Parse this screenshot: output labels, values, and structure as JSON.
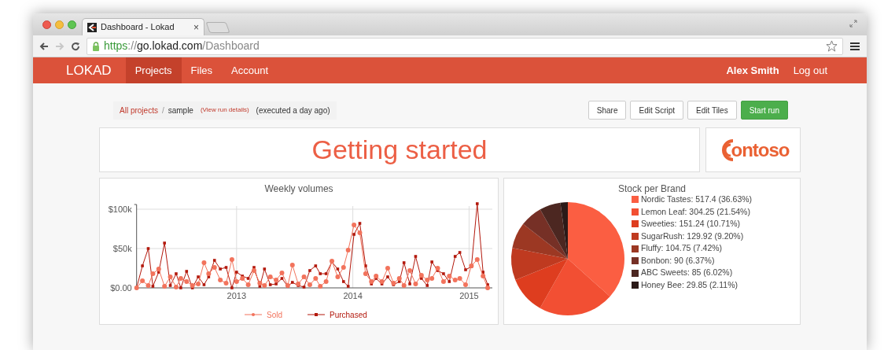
{
  "browser": {
    "tab": {
      "title": "Dashboard - Lokad",
      "close": "×"
    },
    "forward_disabled": true,
    "url": {
      "scheme": "https",
      "separator": "://",
      "host": "go.lokad.com",
      "path": "/Dashboard"
    }
  },
  "navbar": {
    "brand": "LOKAD",
    "items": [
      {
        "label": "Projects",
        "selected": true
      },
      {
        "label": "Files",
        "selected": false
      },
      {
        "label": "Account",
        "selected": false
      }
    ],
    "user": "Alex Smith",
    "logout": "Log out"
  },
  "breadcrumb": {
    "root": "All projects",
    "separator": "/",
    "current": "sample",
    "details_link": "(View run details)",
    "status": "(executed a day ago)"
  },
  "actions": [
    {
      "label": "Share",
      "kind": "default"
    },
    {
      "label": "Edit Script",
      "kind": "default"
    },
    {
      "label": "Edit Tiles",
      "kind": "default"
    },
    {
      "label": "Start run",
      "kind": "primary"
    }
  ],
  "title_tile": {
    "text": "Getting started"
  },
  "logo_tile": {
    "text": "ontoso"
  },
  "line_tile": {
    "chart_data": {
      "type": "line",
      "title": "Weekly volumes",
      "x": [
        2012.14,
        2012.19,
        2012.24,
        2012.28,
        2012.33,
        2012.38,
        2012.43,
        2012.48,
        2012.52,
        2012.57,
        2012.62,
        2012.67,
        2012.72,
        2012.76,
        2012.81,
        2012.86,
        2012.91,
        2012.96,
        2013.0,
        2013.05,
        2013.1,
        2013.15,
        2013.2,
        2013.24,
        2013.29,
        2013.34,
        2013.39,
        2013.44,
        2013.48,
        2013.53,
        2013.58,
        2013.63,
        2013.68,
        2013.72,
        2013.77,
        2013.82,
        2013.87,
        2013.92,
        2013.96,
        2014.01,
        2014.06,
        2014.11,
        2014.16,
        2014.2,
        2014.25,
        2014.3,
        2014.35,
        2014.4,
        2014.44,
        2014.49,
        2014.54,
        2014.59,
        2014.64,
        2014.68,
        2014.73,
        2014.78,
        2014.83,
        2014.88,
        2014.92,
        2014.97,
        2015.02,
        2015.07,
        2015.12,
        2015.16
      ],
      "series": [
        {
          "name": "Sold",
          "color": "#f2735c",
          "marker": "circle",
          "values": [
            0,
            9000,
            3000,
            18000,
            24000,
            2000,
            14000,
            1000,
            12000,
            8000,
            3000,
            5000,
            32000,
            18000,
            26000,
            10000,
            6000,
            36000,
            8000,
            12000,
            4000,
            22000,
            6000,
            3000,
            14000,
            10000,
            19000,
            3000,
            29000,
            5000,
            14000,
            4000,
            12000,
            2000,
            8000,
            34000,
            14000,
            26000,
            48000,
            80000,
            70000,
            18000,
            8000,
            15000,
            8000,
            25000,
            6000,
            12000,
            3000,
            22000,
            5000,
            16000,
            10000,
            12000,
            25000,
            8000,
            15000,
            10000,
            12000,
            4000,
            28000,
            36000,
            15000,
            0
          ]
        },
        {
          "name": "Purchased",
          "color": "#b3190d",
          "marker": "square",
          "values": [
            0,
            28000,
            50000,
            2000,
            20000,
            57000,
            3000,
            18000,
            0,
            21000,
            0,
            14000,
            4000,
            14000,
            35000,
            24000,
            26000,
            0,
            20000,
            15000,
            12000,
            26000,
            2000,
            24000,
            4000,
            5000,
            12000,
            2000,
            7000,
            3000,
            1000,
            22000,
            28000,
            18000,
            18000,
            33000,
            24000,
            8000,
            2000,
            68000,
            82000,
            28000,
            5000,
            12000,
            5000,
            14000,
            4000,
            8000,
            32000,
            5000,
            40000,
            12000,
            3000,
            33000,
            22000,
            18000,
            8000,
            40000,
            45000,
            23000,
            27000,
            107000,
            20000,
            4000
          ]
        }
      ],
      "grid": true,
      "legend": true,
      "xlim": [
        2012.14,
        2015.2
      ],
      "ylim": [
        0,
        107000
      ],
      "xticks": [
        2013,
        2014,
        2015
      ],
      "yticks": [
        {
          "value": 0,
          "label": "$0.00"
        },
        {
          "value": 50000,
          "label": "$50k"
        },
        {
          "value": 100000,
          "label": "$100k"
        }
      ]
    }
  },
  "pie_tile": {
    "chart_data": {
      "type": "pie",
      "title": "Stock per Brand",
      "values": [
        36.63,
        21.54,
        10.71,
        9.2,
        7.42,
        6.37,
        6.02,
        2.11
      ]
    },
    "legend": [
      {
        "label": "Nordic Tastes: 517.4 (36.63%)",
        "color": "#fb5e42"
      },
      {
        "label": "Lemon Leaf: 304.25 (21.54%)",
        "color": "#f24f33"
      },
      {
        "label": "Sweeties: 151.24 (10.71%)",
        "color": "#de3d1f"
      },
      {
        "label": "SugarRush: 129.92 (9.20%)",
        "color": "#bf3a20"
      },
      {
        "label": "Fluffy: 104.75 (7.42%)",
        "color": "#9c3823"
      },
      {
        "label": "Bonbon: 90 (6.37%)",
        "color": "#763026"
      },
      {
        "label": "ABC Sweets: 85 (6.02%)",
        "color": "#4c2721"
      },
      {
        "label": "Honey Bee: 29.85 (2.11%)",
        "color": "#2b1a18"
      }
    ]
  }
}
